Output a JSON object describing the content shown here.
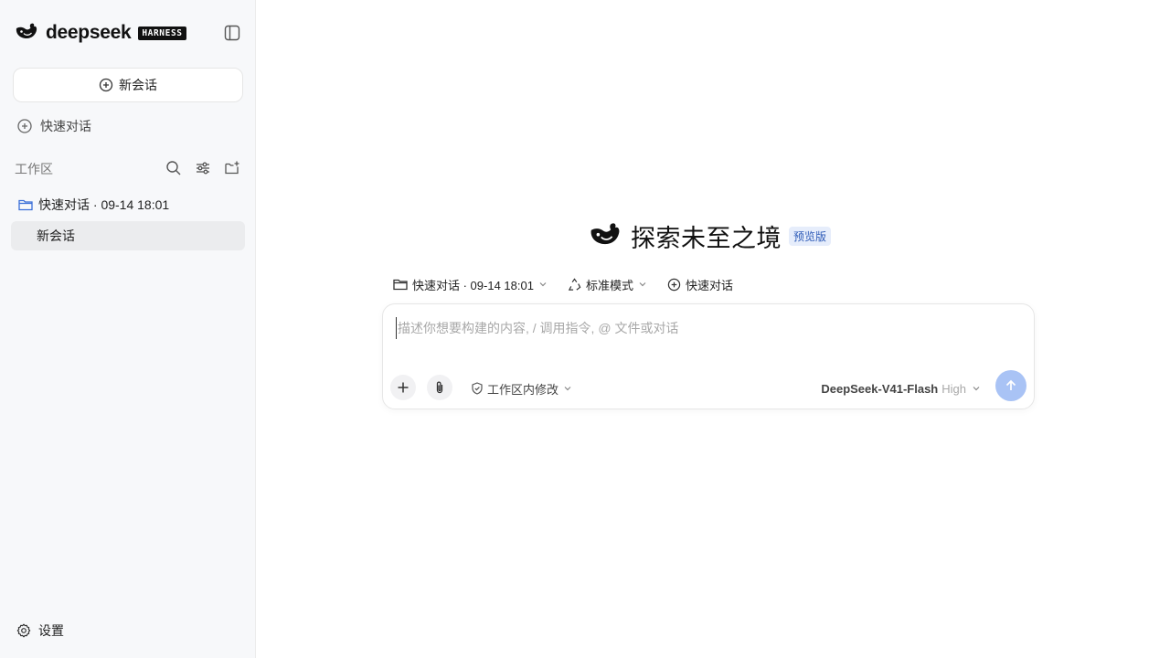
{
  "sidebar": {
    "brand": {
      "name": "deepseek",
      "badge": "HARNESS"
    },
    "new_chat_label": "新会话",
    "quick_chat_label": "快速对话",
    "workspace": {
      "label": "工作区",
      "actions": [
        "search-icon",
        "filter-sliders-icon",
        "new-folder-icon"
      ],
      "folder": {
        "label": "快速对话 · 09-14 18:01",
        "icon": "folder-icon",
        "icon_color": "#3b6fd8"
      },
      "sessions": [
        {
          "label": "新会话",
          "selected": true
        }
      ]
    },
    "settings_label": "设置"
  },
  "main": {
    "hero_title": "探索未至之境",
    "hero_badge": "预览版",
    "toolbar": {
      "folder_label": "快速对话 · 09-14 18:01",
      "mode_label": "标准模式",
      "quick_label": "快速对话"
    },
    "composer": {
      "placeholder": "描述你想要构建的内容, / 调用指令, @ 文件或对话",
      "value": "",
      "scope_label": "工作区内修改",
      "model_name": "DeepSeek-V41-Flash",
      "model_level": "High"
    }
  },
  "colors": {
    "sidebar_bg": "#f7f8fa",
    "accent": "#3b6fd8",
    "send_button": "#a9c3f5",
    "selected_item_bg": "#ebecee"
  }
}
